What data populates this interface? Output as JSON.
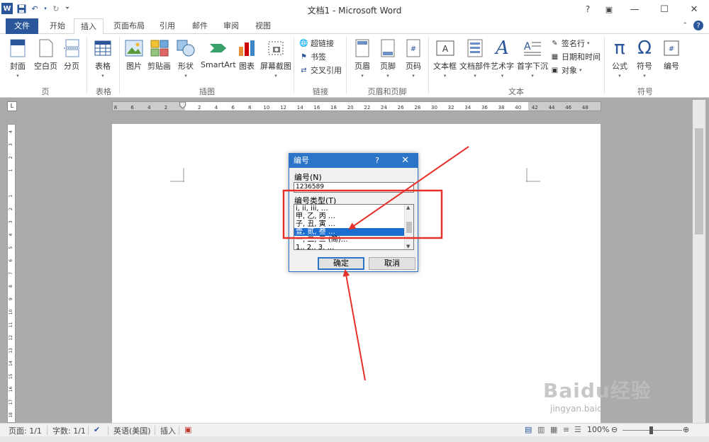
{
  "window": {
    "title": "文档1 - Microsoft Word",
    "app_logo": "W",
    "qat_icons": [
      "save-icon",
      "undo-icon",
      "redo-icon",
      "customize-icon"
    ]
  },
  "tabs": [
    {
      "label": "文件",
      "type": "file"
    },
    {
      "label": "开始"
    },
    {
      "label": "插入",
      "active": true
    },
    {
      "label": "页面布局"
    },
    {
      "label": "引用"
    },
    {
      "label": "邮件"
    },
    {
      "label": "审阅"
    },
    {
      "label": "视图"
    }
  ],
  "ribbon": {
    "page_group": {
      "label": "页",
      "buttons": [
        "封面",
        "空白页",
        "分页"
      ]
    },
    "table_group": {
      "label": "表格",
      "buttons": [
        "表格"
      ]
    },
    "illustration_group": {
      "label": "插图",
      "buttons": [
        "图片",
        "剪贴画",
        "形状",
        "SmartArt",
        "图表",
        "屏幕截图"
      ]
    },
    "links_group": {
      "label": "链接",
      "buttons": [
        "超链接",
        "书签",
        "交叉引用"
      ]
    },
    "header_footer_group": {
      "label": "页眉和页脚",
      "buttons": [
        "页眉",
        "页脚",
        "页码"
      ]
    },
    "text_group": {
      "label": "文本",
      "buttons": [
        "文本框",
        "文档部件",
        "艺术字",
        "首字下沉"
      ],
      "small": [
        "签名行",
        "日期和时间",
        "对象"
      ]
    },
    "symbols_group": {
      "label": "符号",
      "buttons": [
        "公式",
        "符号",
        "编号"
      ]
    }
  },
  "ruler": {
    "h_ticks": [
      "8",
      "6",
      "4",
      "2",
      "",
      "2",
      "4",
      "6",
      "8",
      "10",
      "12",
      "14",
      "16",
      "18",
      "20",
      "22",
      "24",
      "26",
      "28",
      "30",
      "32",
      "34",
      "36",
      "38",
      "40",
      "42",
      "44",
      "46",
      "48"
    ],
    "v_ticks": [
      "4",
      "3",
      "2",
      "1",
      "",
      "1",
      "2",
      "3",
      "4",
      "5",
      "6",
      "7",
      "8",
      "9",
      "10",
      "11",
      "12",
      "13",
      "14",
      "15",
      "16",
      "17",
      "18"
    ]
  },
  "dialog": {
    "title": "编号",
    "help": "?",
    "close": "✕",
    "number_label": "编号(N)",
    "number_value": "1236589",
    "type_label": "编号类型(T)",
    "list_items": [
      "i, ii, iii, …",
      "甲, 乙, 丙 …",
      "子, 丑, 寅 …",
      "壹, 贰, 叁 …",
      "一, 二, 三 (简)…",
      "1., 2., 3. …"
    ],
    "selected_index": 3,
    "ok_label": "确定",
    "cancel_label": "取消"
  },
  "statusbar": {
    "page": "页面: 1/1",
    "words": "字数: 1/1",
    "language": "英语(美国)",
    "mode": "插入",
    "zoom": "100%"
  },
  "watermark": {
    "main": "Baidu经验",
    "sub": "jingyan.baidu.com"
  },
  "colors": {
    "accent": "#2b579a",
    "dialog_title": "#2b74c7",
    "selection": "#1c6dd0",
    "annotation": "#e8302a"
  }
}
